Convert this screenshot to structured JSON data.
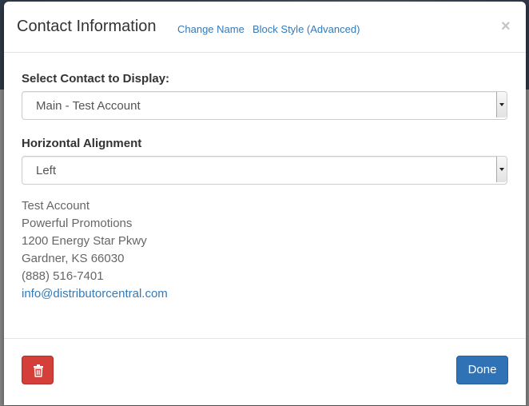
{
  "modal": {
    "title": "Contact Information",
    "links": [
      "Change Name",
      "Block Style (Advanced)"
    ],
    "close_label": "×"
  },
  "contact_select": {
    "label": "Select Contact to Display:",
    "value": "Main - Test Account"
  },
  "alignment_select": {
    "label": "Horizontal Alignment",
    "value": "Left"
  },
  "contact": {
    "name": "Test Account",
    "company": "Powerful Promotions",
    "street": "1200 Energy Star Pkwy",
    "city_state_zip": "Gardner, KS 66030",
    "phone": "(888) 516-7401",
    "email": "info@distributorcentral.com"
  },
  "footer": {
    "delete_icon": "trash-icon",
    "done_label": "Done"
  },
  "colors": {
    "link": "#337ab7",
    "danger": "#d43f3a",
    "primary": "#2f72b5"
  }
}
